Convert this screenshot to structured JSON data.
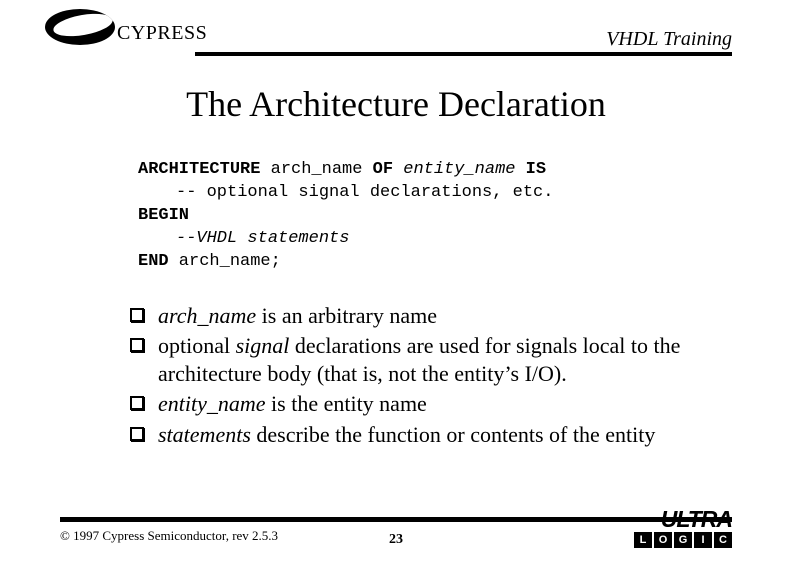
{
  "header": {
    "brand": "CYPRESS",
    "doc_series": "VHDL Training"
  },
  "title": "The Architecture Declaration",
  "code": {
    "line1_kw1": "ARCHITECTURE",
    "line1_mid": " arch_name ",
    "line1_kw2": "OF",
    "line1_it": " entity_name ",
    "line1_kw3": "IS",
    "line2": "-- optional signal declarations, etc.",
    "line3_kw": "BEGIN",
    "line4_it": "--VHDL statements",
    "line5_kw": "END",
    "line5_rest": " arch_name;"
  },
  "bullets": [
    {
      "it": "arch_name",
      "text": " is an arbitrary name"
    },
    {
      "pre": "optional ",
      "it": "signal",
      "text": " declarations are used for signals local to the architecture body (that is, not the entity’s I/O)."
    },
    {
      "it": "entity_name",
      "text": " is the entity name"
    },
    {
      "it": "statements",
      "text": " describe the function or contents of the entity"
    }
  ],
  "footer": {
    "copyright": "© 1997 Cypress Semiconductor, rev 2.5.3",
    "page": "23",
    "ultra_word": "ULTRA",
    "ultra_letters": [
      "L",
      "O",
      "G",
      "I",
      "C"
    ]
  }
}
